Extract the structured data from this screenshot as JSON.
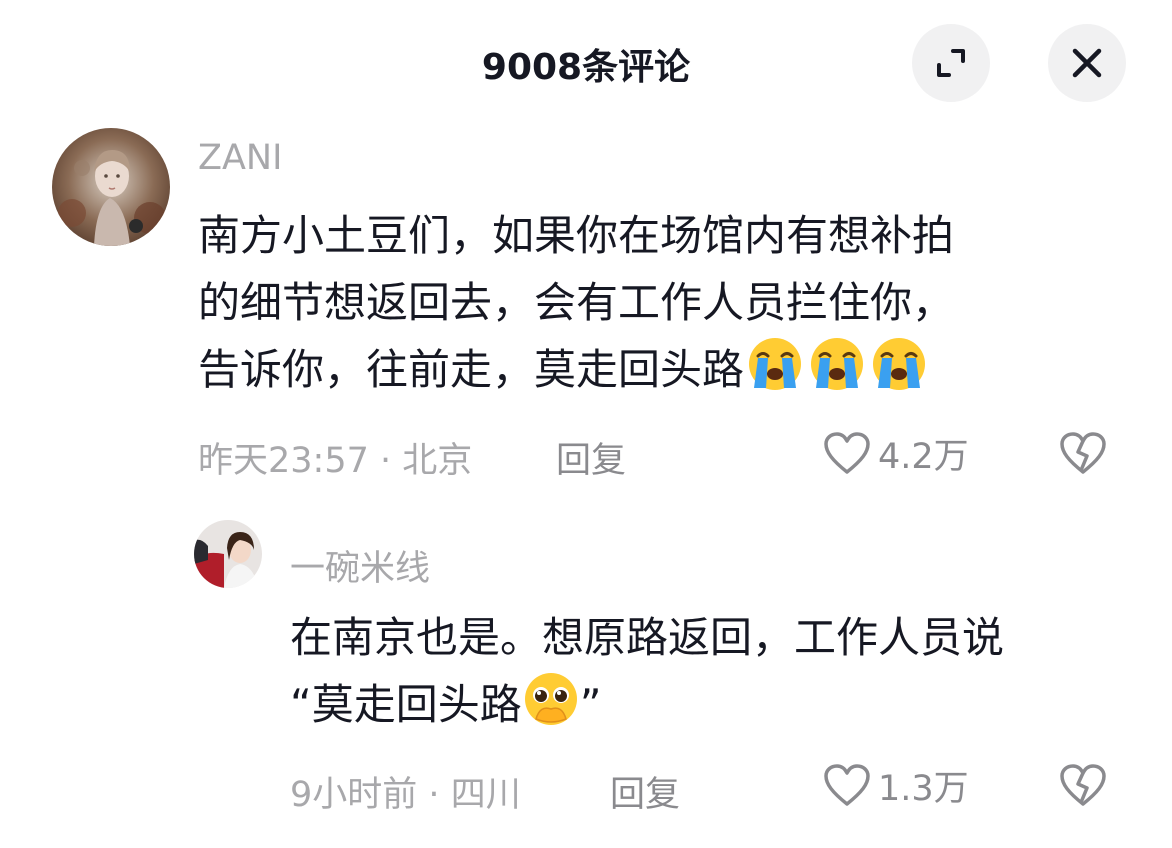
{
  "header": {
    "title": "9008条评论",
    "expand_icon": "expand-icon",
    "close_icon": "close-icon"
  },
  "comments": [
    {
      "username": "ZANI",
      "content_lines": [
        "南方小土豆们，如果你在场馆内有想补拍",
        "的细节想返回去，会有工作人员拦住你，",
        "告诉你，往前走，莫走回头路"
      ],
      "emojis": [
        "loudly-crying-face",
        "loudly-crying-face",
        "loudly-crying-face"
      ],
      "time": "昨天23:57",
      "location": "北京",
      "separator": "·",
      "reply_label": "回复",
      "likes": "4.2万"
    },
    {
      "username": "一碗米线",
      "content_lines": [
        "在南京也是。想原路返回，工作人员说",
        "“莫走回头路",
        "”"
      ],
      "emojis": [
        "pleading-face-hands-over-mouth"
      ],
      "time": "9小时前",
      "location": "四川",
      "separator": "·",
      "reply_label": "回复",
      "likes": "1.3万"
    }
  ],
  "colors": {
    "primary_text": "#161823",
    "secondary_text": "#a8a8ab",
    "icon_gray": "#8a8a8e",
    "button_bg": "#f1f1f2",
    "emoji_yellow": "#ffcc33",
    "tear_blue": "#3aa0f0"
  }
}
